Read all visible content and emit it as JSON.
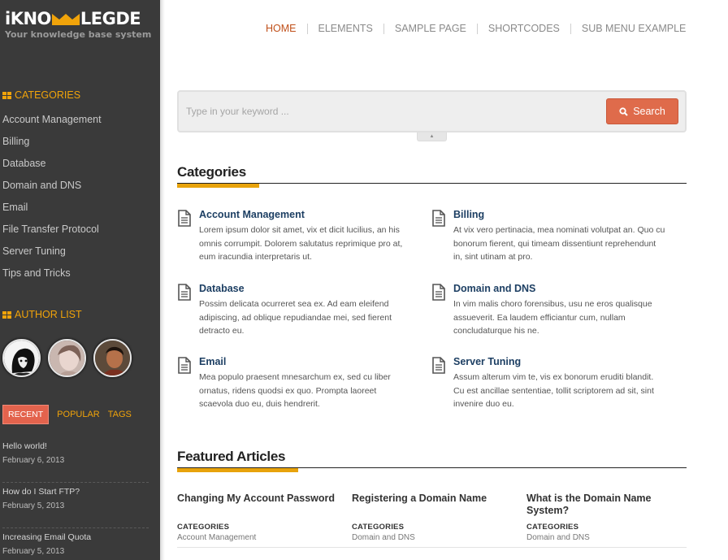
{
  "brand": {
    "title_left": "iKNO",
    "title_right": "LEGDE",
    "tagline": "Your knowledge base system",
    "accent": "#f0a30a"
  },
  "nav": {
    "items": [
      {
        "label": "HOME",
        "active": true
      },
      {
        "label": "ELEMENTS"
      },
      {
        "label": "SAMPLE PAGE"
      },
      {
        "label": "SHORTCODES"
      },
      {
        "label": "SUB MENU EXAMPLE"
      }
    ]
  },
  "sidebar": {
    "categories_heading": "CATEGORIES",
    "categories": [
      "Account Management",
      "Billing",
      "Database",
      "Domain and DNS",
      "Email",
      "File Transfer Protocol",
      "Server Tuning",
      "Tips and Tricks"
    ],
    "authors_heading": "AUTHOR LIST",
    "tabs": {
      "recent": "RECENT",
      "popular": "POPULAR",
      "tags": "TAGS"
    },
    "recent_posts": [
      {
        "title": "Hello world!",
        "date": "February 6, 2013"
      },
      {
        "title": "How do I Start FTP?",
        "date": "February 5, 2013"
      },
      {
        "title": "Increasing Email Quota",
        "date": "February 5, 2013"
      }
    ]
  },
  "search": {
    "placeholder": "Type in your keyword ...",
    "button_label": "Search",
    "toggle_glyph": "▲"
  },
  "categories_section": {
    "title": "Categories",
    "items": [
      {
        "title": "Account Management",
        "desc": "Lorem ipsum dolor sit amet, vix et dicit lucilius, an his omnis corrumpit. Dolorem salutatus reprimique pro at, eum iracundia interpretaris ut."
      },
      {
        "title": "Billing",
        "desc": "At vix vero pertinacia, mea nominati volutpat an. Quo cu bonorum fierent, qui timeam dissentiunt reprehendunt in, sint utinam at pro."
      },
      {
        "title": "Database",
        "desc": "Possim delicata ocurreret sea ex. Ad eam eleifend adipiscing, ad oblique repudiandae mei, sed fierent detracto eu."
      },
      {
        "title": "Domain and DNS",
        "desc": "In vim malis choro forensibus, usu ne eros qualisque assueverit. Ea laudem efficiantur cum, nullam concludaturque his ne."
      },
      {
        "title": "Email",
        "desc": "Mea populo praesent mnesarchum ex, sed cu liber ornatus, ridens quodsi ex quo. Prompta laoreet scaevola duo eu, duis hendrerit."
      },
      {
        "title": "Server Tuning",
        "desc": "Assum alterum vim te, vis ex bonorum eruditi blandit. Cu est ancillae sententiae, tollit scriptorem ad sit, sint invenire duo eu."
      }
    ]
  },
  "featured_section": {
    "title": "Featured Articles",
    "items": [
      {
        "title": "Changing My Account Password",
        "cat_label": "CATEGORIES",
        "category": "Account Management"
      },
      {
        "title": "Registering a Domain Name",
        "cat_label": "CATEGORIES",
        "category": "Domain and DNS"
      },
      {
        "title": "What is the Domain Name System?",
        "cat_label": "CATEGORIES",
        "category": "Domain and DNS"
      }
    ]
  }
}
